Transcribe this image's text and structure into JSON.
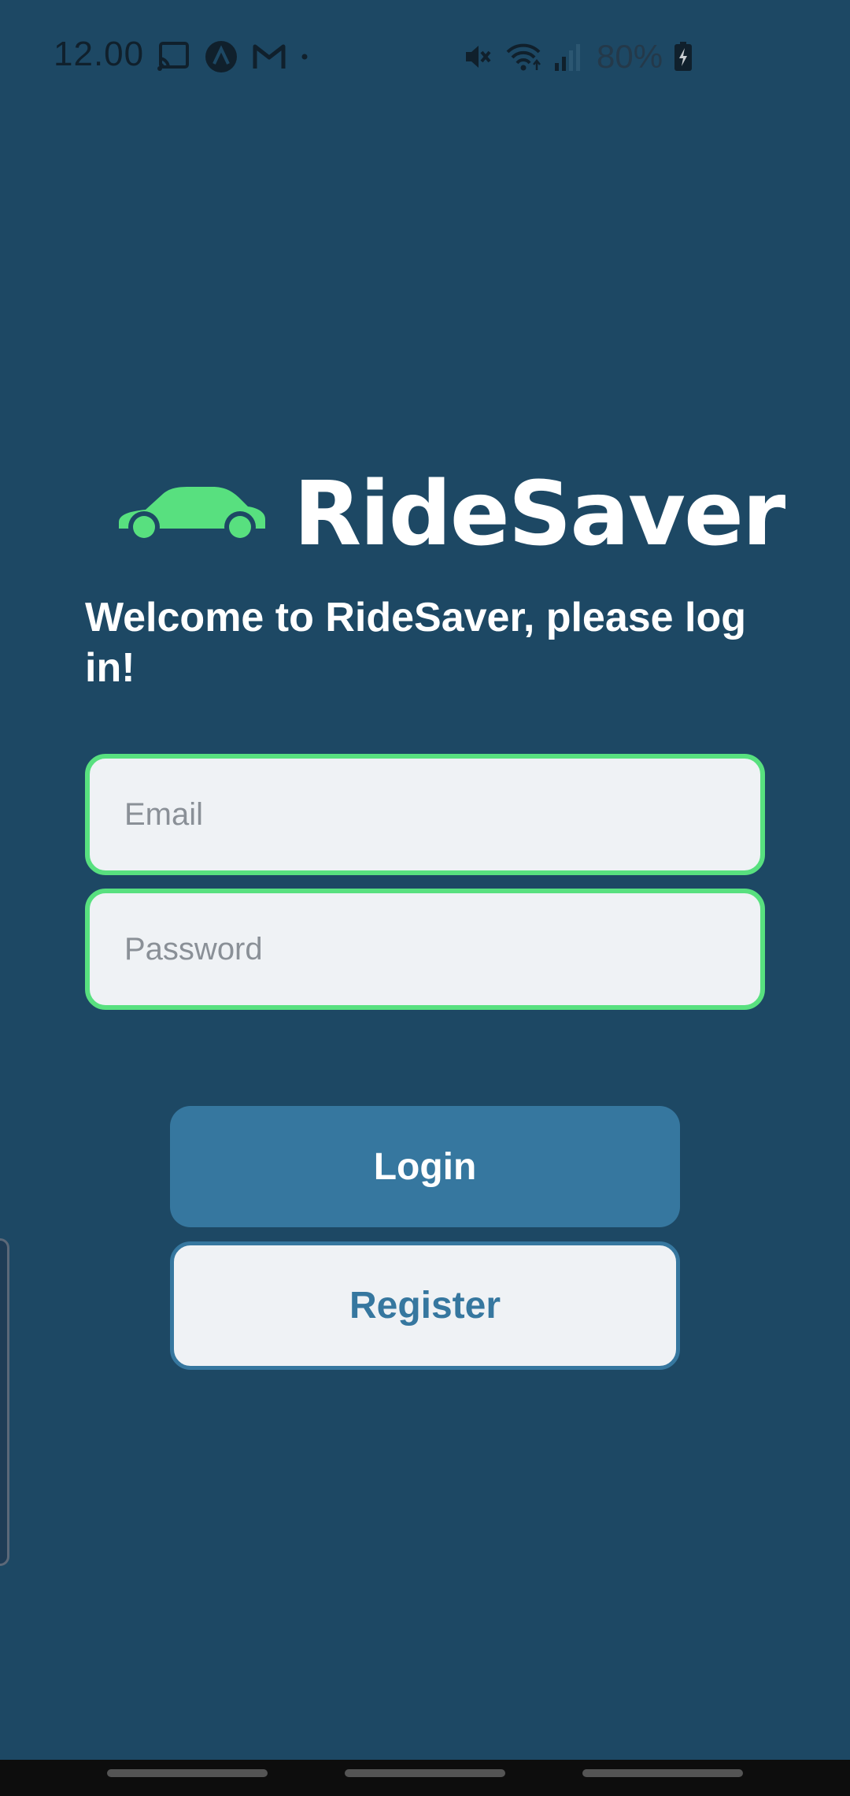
{
  "status_bar": {
    "time": "12.00",
    "battery": "80%",
    "icons_left": [
      "cast-icon",
      "app-a-icon",
      "gmail-icon",
      "dot-icon"
    ],
    "icons_right": [
      "mute-icon",
      "wifi-icon",
      "signal-icon",
      "battery-charging-icon"
    ]
  },
  "logo": {
    "icon": "car-icon",
    "text": "RideSaver",
    "icon_color": "#58e07f"
  },
  "welcome": "Welcome to RideSaver, please log in!",
  "form": {
    "email_placeholder": "Email",
    "email_value": "",
    "password_placeholder": "Password",
    "password_value": ""
  },
  "buttons": {
    "login": "Login",
    "register": "Register"
  },
  "colors": {
    "background": "#1d4864",
    "accent_green": "#58e07f",
    "primary_blue": "#36779f",
    "field_bg": "#eff2f5"
  }
}
